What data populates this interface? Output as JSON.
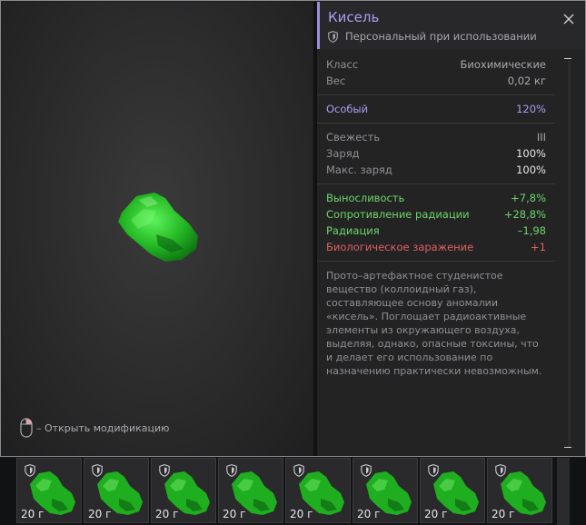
{
  "preview": {
    "hint_text": "– Открыть модификацию",
    "mouse_icon": "mouse-right-click-icon"
  },
  "item": {
    "title": "Кисель",
    "subtitle": "Персональный при использовании",
    "subtitle_icon": "shield-icon",
    "close_icon": "close-icon"
  },
  "stats": {
    "basic": [
      {
        "label": "Класс",
        "value": "Биохимические"
      },
      {
        "label": "Вес",
        "value": "0,02 кг"
      }
    ],
    "rarity": {
      "label": "Особый",
      "value": "120%"
    },
    "condition": [
      {
        "label": "Свежесть",
        "value": "III"
      },
      {
        "label": "Заряд",
        "value": "100%"
      },
      {
        "label": "Макс. заряд",
        "value": "100%"
      }
    ],
    "effects": [
      {
        "label": "Выносливость",
        "value": "+7,8%",
        "tone": "green"
      },
      {
        "label": "Сопротивление радиации",
        "value": "+28,8%",
        "tone": "green"
      },
      {
        "label": "Радиация",
        "value": "–1,98",
        "tone": "green"
      },
      {
        "label": "Биологическое заражение",
        "value": "+1",
        "tone": "red"
      }
    ],
    "description": "Прото–артефактное студенистое вещество (коллоидный газ), составляющее основу аномалии «кисель». Поглощает радиоактивные элементы из окружающего воздуха, выделяя, однако, опасные токсины, что и делает его использование по назначению практически невозможным."
  },
  "belt": {
    "slots": [
      {
        "weight": "20 г"
      },
      {
        "weight": "20 г"
      },
      {
        "weight": "20 г"
      },
      {
        "weight": "20 г"
      },
      {
        "weight": "20 г"
      },
      {
        "weight": "20 г"
      },
      {
        "weight": "20 г"
      },
      {
        "weight": "20 г"
      }
    ]
  },
  "colors": {
    "accent": "#a99df0",
    "positive": "#6ed56a",
    "negative": "#e15f5f",
    "artifact_green": "#2ecf2e"
  }
}
